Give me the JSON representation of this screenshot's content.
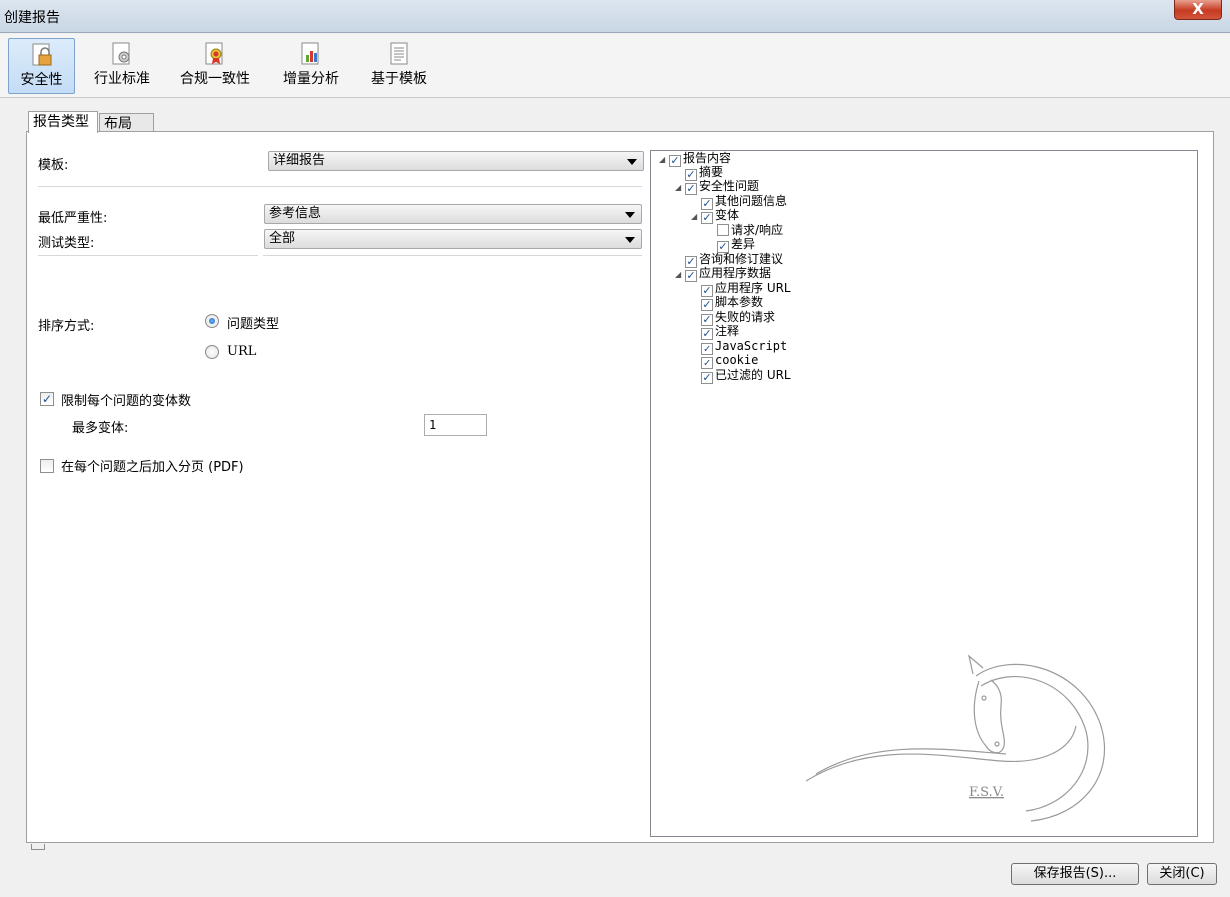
{
  "window": {
    "title": "创建报告",
    "close_glyph": "X"
  },
  "toolbar": {
    "items": [
      {
        "label": "安全性",
        "icon": "lock-document-icon",
        "selected": true
      },
      {
        "label": "行业标准",
        "icon": "gear-document-icon",
        "selected": false
      },
      {
        "label": "合规一致性",
        "icon": "ribbon-document-icon",
        "selected": false
      },
      {
        "label": "增量分析",
        "icon": "chart-document-icon",
        "selected": false
      },
      {
        "label": "基于模板",
        "icon": "template-document-icon",
        "selected": false
      }
    ]
  },
  "tabs": [
    {
      "label": "报告类型",
      "active": true
    },
    {
      "label": "布局",
      "active": false
    }
  ],
  "form": {
    "template_label": "模板:",
    "template_value": "详细报告",
    "min_severity_label": "最低严重性:",
    "min_severity_value": "参考信息",
    "test_type_label": "测试类型:",
    "test_type_value": "全部",
    "sort_label": "排序方式:",
    "sort_options": [
      {
        "label": "问题类型",
        "checked": true
      },
      {
        "label": "URL",
        "checked": false
      }
    ],
    "limit_variants_label": "限制每个问题的变体数",
    "limit_variants_checked": true,
    "max_variants_label": "最多变体:",
    "max_variants_value": "1",
    "page_break_label": "在每个问题之后加入分页 (PDF)",
    "page_break_checked": false
  },
  "tree": [
    {
      "label": "报告内容",
      "checked": true,
      "expanded": true
    },
    {
      "label": "摘要",
      "checked": true
    },
    {
      "label": "安全性问题",
      "checked": true,
      "expanded": true
    },
    {
      "label": "其他问题信息",
      "checked": true
    },
    {
      "label": "变体",
      "checked": true,
      "expanded": true
    },
    {
      "label": "请求/响应",
      "checked": false
    },
    {
      "label": "差异",
      "checked": true
    },
    {
      "label": "咨询和修订建议",
      "checked": true
    },
    {
      "label": "应用程序数据",
      "checked": true,
      "expanded": true
    },
    {
      "label": "应用程序 URL",
      "checked": true
    },
    {
      "label": "脚本参数",
      "checked": true
    },
    {
      "label": "失败的请求",
      "checked": true
    },
    {
      "label": "注释",
      "checked": true
    },
    {
      "label": "JavaScript",
      "checked": true
    },
    {
      "label": "cookie",
      "checked": true
    },
    {
      "label": "已过滤的 URL",
      "checked": true
    }
  ],
  "watermark_text": "F.S.V.",
  "footer": {
    "save_label": "保存报告(S)...",
    "close_label": "关闭(C)"
  }
}
